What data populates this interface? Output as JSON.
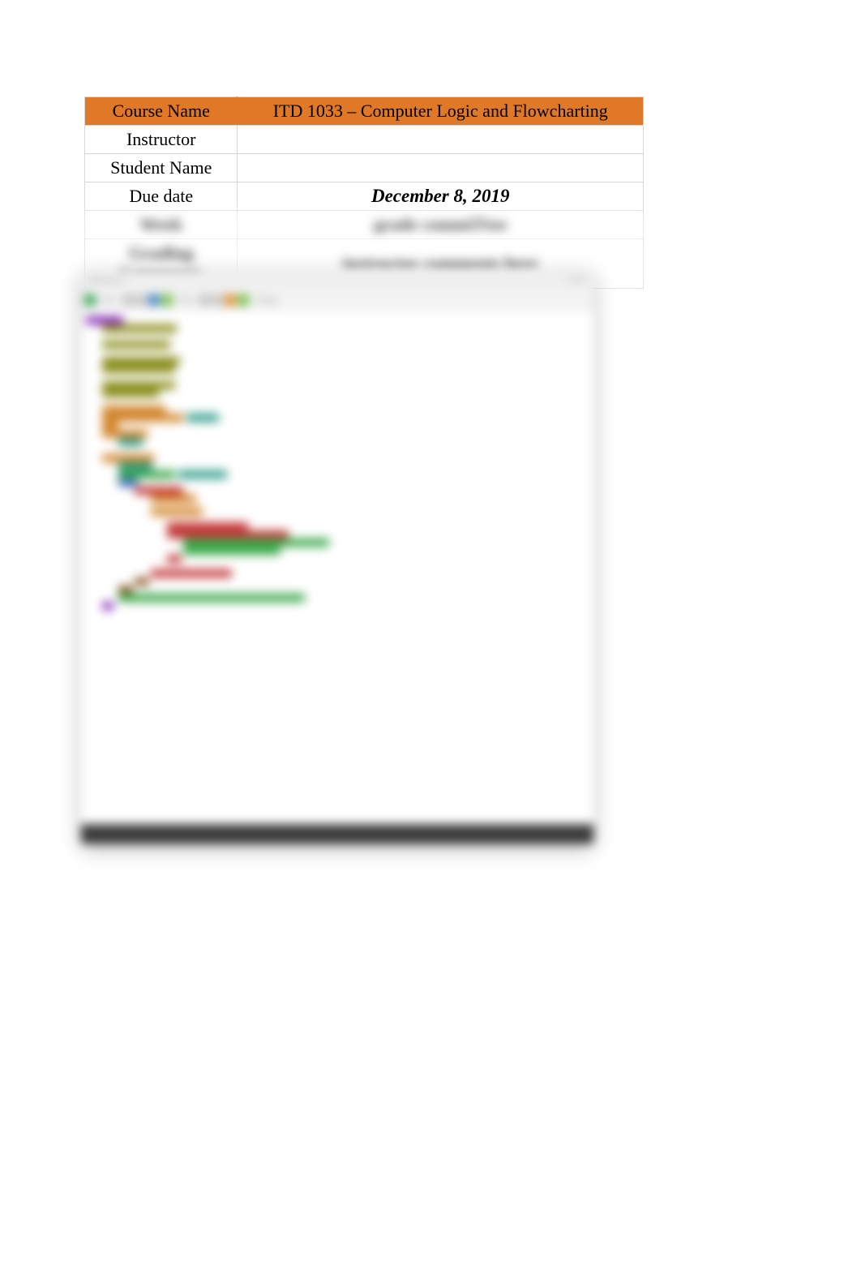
{
  "info": {
    "rows": [
      {
        "left": "Course Name",
        "right": "ITD 1033 – Computer Logic and Flowcharting"
      },
      {
        "left": "Instructor",
        "right": ""
      },
      {
        "left": "Student Name",
        "right": ""
      },
      {
        "left": "Due date",
        "right": "December 8, 2019"
      },
      {
        "left": "Week",
        "right": "grade commiTtee"
      },
      {
        "left": "Grading Comments",
        "right": "instructor comments here"
      }
    ]
  },
  "ide": {
    "title_left": "main.java ×",
    "title_right": "1   of 1",
    "toolbar_text": [
      "Run",
      "Edit",
      "Debug"
    ]
  }
}
